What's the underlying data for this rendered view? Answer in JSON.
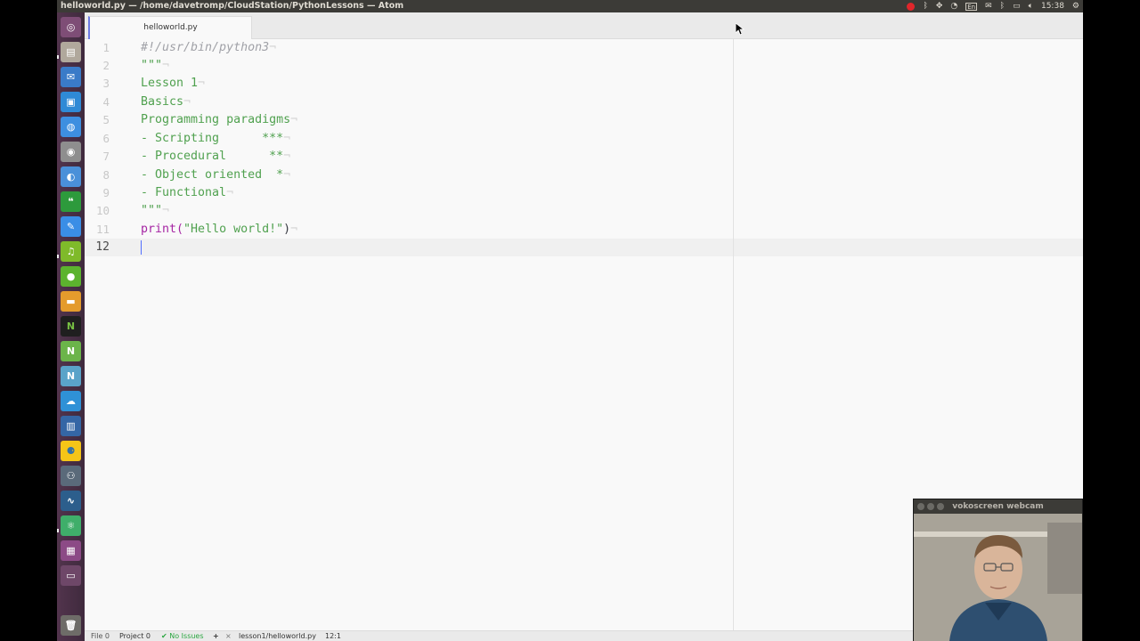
{
  "window_title": "helloworld.py — /home/davetromp/CloudStation/PythonLessons — Atom",
  "indicators": {
    "keyboard_layout": "En",
    "clock": "15:38"
  },
  "tabs": [
    {
      "label": "helloworld.py"
    }
  ],
  "editor": {
    "line_numbers": [
      "1",
      "2",
      "3",
      "4",
      "5",
      "6",
      "7",
      "8",
      "9",
      "10",
      "11",
      "12"
    ],
    "lines": [
      {
        "text": "#!/usr/bin/python3",
        "style": "comment"
      },
      {
        "text": "\"\"\"",
        "style": "comment"
      },
      {
        "text": "Lesson 1",
        "style": "str"
      },
      {
        "text": "Basics",
        "style": "str"
      },
      {
        "text": "Programming paradigms",
        "style": "str"
      },
      {
        "text": "- Scripting      ***",
        "style": "str"
      },
      {
        "text": "- Procedural      **",
        "style": "str"
      },
      {
        "text": "- Object oriented  *",
        "style": "str"
      },
      {
        "text": "- Functional",
        "style": "str"
      },
      {
        "text": "\"\"\"",
        "style": "str"
      },
      {
        "text_fn": "print(",
        "text_str": "\"Hello world!\"",
        "text_close": ")",
        "style": "code"
      },
      {
        "text": "",
        "style": "plain"
      }
    ],
    "eol_marker": "¬"
  },
  "status_bar": {
    "file": "File 0",
    "project": "Project 0",
    "issues": "✔ No Issues",
    "add": "+",
    "path": "lesson1/helloworld.py",
    "cursor_pos": "12:1"
  },
  "webcam": {
    "title": "vokoscreen webcam"
  },
  "colors": {
    "accent": "#526fff",
    "string": "#50a14f",
    "function": "#a626a4",
    "comment": "#a0a1a7"
  }
}
